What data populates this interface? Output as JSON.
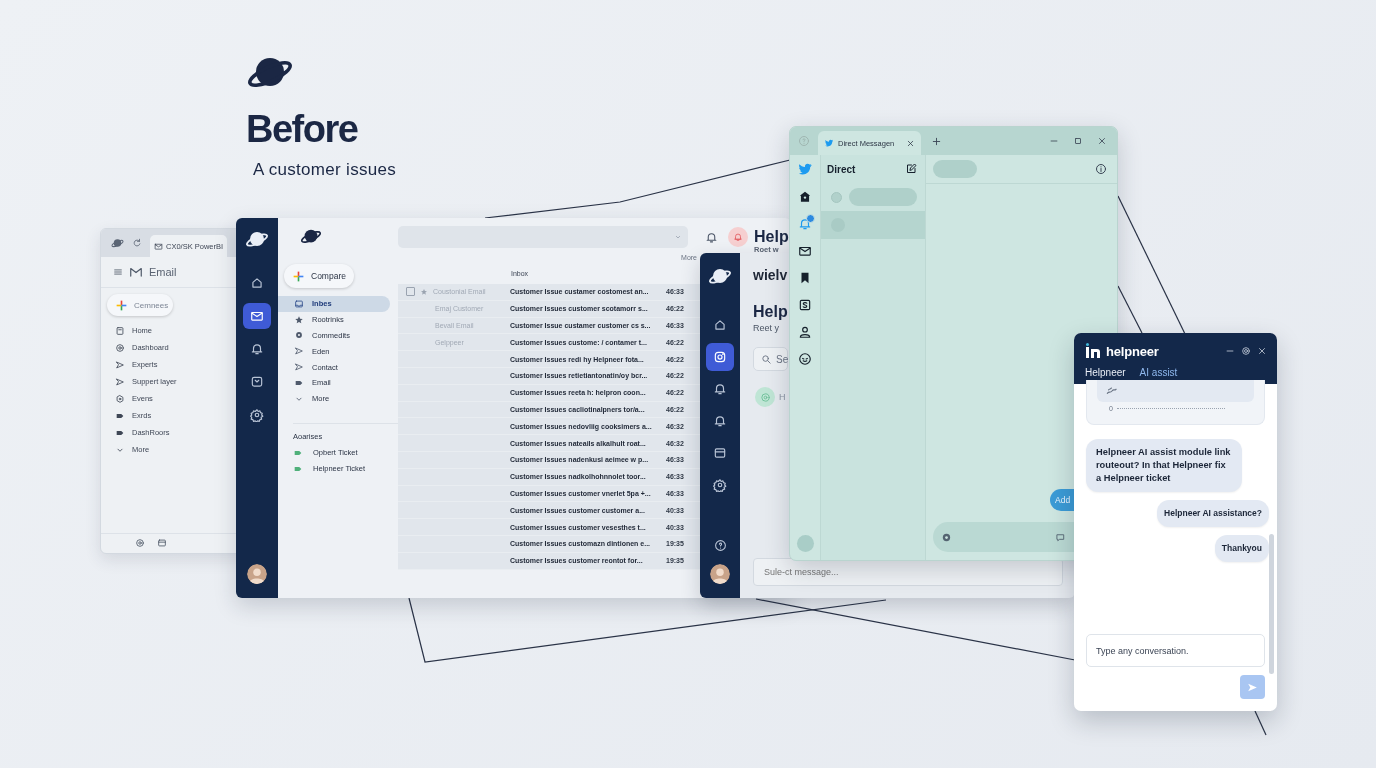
{
  "header": {
    "title": "Before",
    "subtitle": "A customer issues"
  },
  "email_window": {
    "tab": "CX0/SK PowerBI",
    "app_name": "Email",
    "compose": "Cemnees",
    "nav": [
      "Home",
      "Dashboard",
      "Experts",
      "Suppert layer",
      "Evens",
      "Exrds",
      "DashRoors",
      "More"
    ]
  },
  "inbox_window": {
    "rail": [
      {
        "selected": false
      },
      {
        "selected": true
      },
      {
        "selected": false
      },
      {
        "selected": false
      },
      {
        "selected": false
      }
    ],
    "header_title": "Help",
    "header_subtitle": "Roet w",
    "compose": "Compare",
    "nav": [
      {
        "label": "Inbes",
        "selected": true
      },
      {
        "label": "Rootrinks",
        "selected": false
      },
      {
        "label": "Commedits",
        "selected": false
      },
      {
        "label": "Eden",
        "selected": false
      },
      {
        "label": "Contact",
        "selected": false
      },
      {
        "label": "Email",
        "selected": false
      },
      {
        "label": "More",
        "selected": false
      }
    ],
    "section": "Aoarises",
    "labels": [
      "Opbert Ticket",
      "Helpneer Ticket"
    ],
    "more": "More",
    "table_title": "Inbox",
    "rows": [
      {
        "checked": false,
        "sender": "Coustonial Email",
        "subject": "Customer Issue custamer costomest an...",
        "time": "46:33"
      },
      {
        "sender": "Emaj Customer",
        "subject": "Customer Issues customer scotamorr s...",
        "time": "46:22"
      },
      {
        "sender": "Bevall Email",
        "subject": "Customer Issue custamer customer cs s...",
        "time": "46:33"
      },
      {
        "sender": "Gelppeer",
        "subject": "Customer Issues custome: / contamer t...",
        "time": "46:22"
      },
      {
        "subject": "Customer Issues redi hy Helpneer fota...",
        "time": "46:22"
      },
      {
        "subject": "Customer Issues retietiantonatin/oy bcr...",
        "time": "46:22"
      },
      {
        "subject": "Customer Issues reeta h: helpron coon...",
        "time": "46:22"
      },
      {
        "subject": "Customer Issues cacliotinalpners tor/a...",
        "time": "46:22"
      },
      {
        "subject": "Customer Issues nedovliig cooksimers a...",
        "time": "46:32"
      },
      {
        "subject": "Customer Issues nateails alkalhult roat...",
        "time": "46:32"
      },
      {
        "subject": "Customer Issues nadenkusi aeimee w p...",
        "time": "46:33"
      },
      {
        "subject": "Customer Issues nadkolhohnnolet toor...",
        "time": "46:33"
      },
      {
        "subject": "Customer Issues customer vnerlet 5pa +...",
        "time": "46:33"
      },
      {
        "subject": "Customer Issues customer customer a...",
        "time": "40:33"
      },
      {
        "subject": "Customer Issues customer vesesthes t...",
        "time": "40:33"
      },
      {
        "subject": "Customer Issues customazn dintionen e...",
        "time": "19:35"
      },
      {
        "subject": "Customer Issues customer reontot for...",
        "time": "19:35"
      }
    ]
  },
  "help_window": {
    "rail": [
      {
        "selected": false
      },
      {
        "selected": true
      },
      {
        "selected": false
      },
      {
        "selected": false
      },
      {
        "selected": false
      },
      {
        "selected": false
      }
    ],
    "name": "wielv",
    "title": "Help",
    "subtitle": "Reet y",
    "search_placeholder": "Se",
    "contact": "H",
    "message_placeholder": "Sule-ct message..."
  },
  "dm_window": {
    "tab": "Direct Messagen",
    "column_title": "Direct",
    "button": "Add"
  },
  "helpneer_widget": {
    "brand": "helpneer",
    "tabs": [
      {
        "label": "Helpneer",
        "selected": false
      },
      {
        "label": "AI assist",
        "selected": true
      }
    ],
    "card_value": "0",
    "messages": [
      {
        "kind": "bot",
        "text": "Helpneer AI assist module link routeout? In that Helpneer fix a Helpneer ticket"
      },
      {
        "kind": "user",
        "text": "Helpneer AI assistance?"
      },
      {
        "kind": "user",
        "text": "Thankyou"
      }
    ],
    "placeholder": "Type any conversation."
  }
}
